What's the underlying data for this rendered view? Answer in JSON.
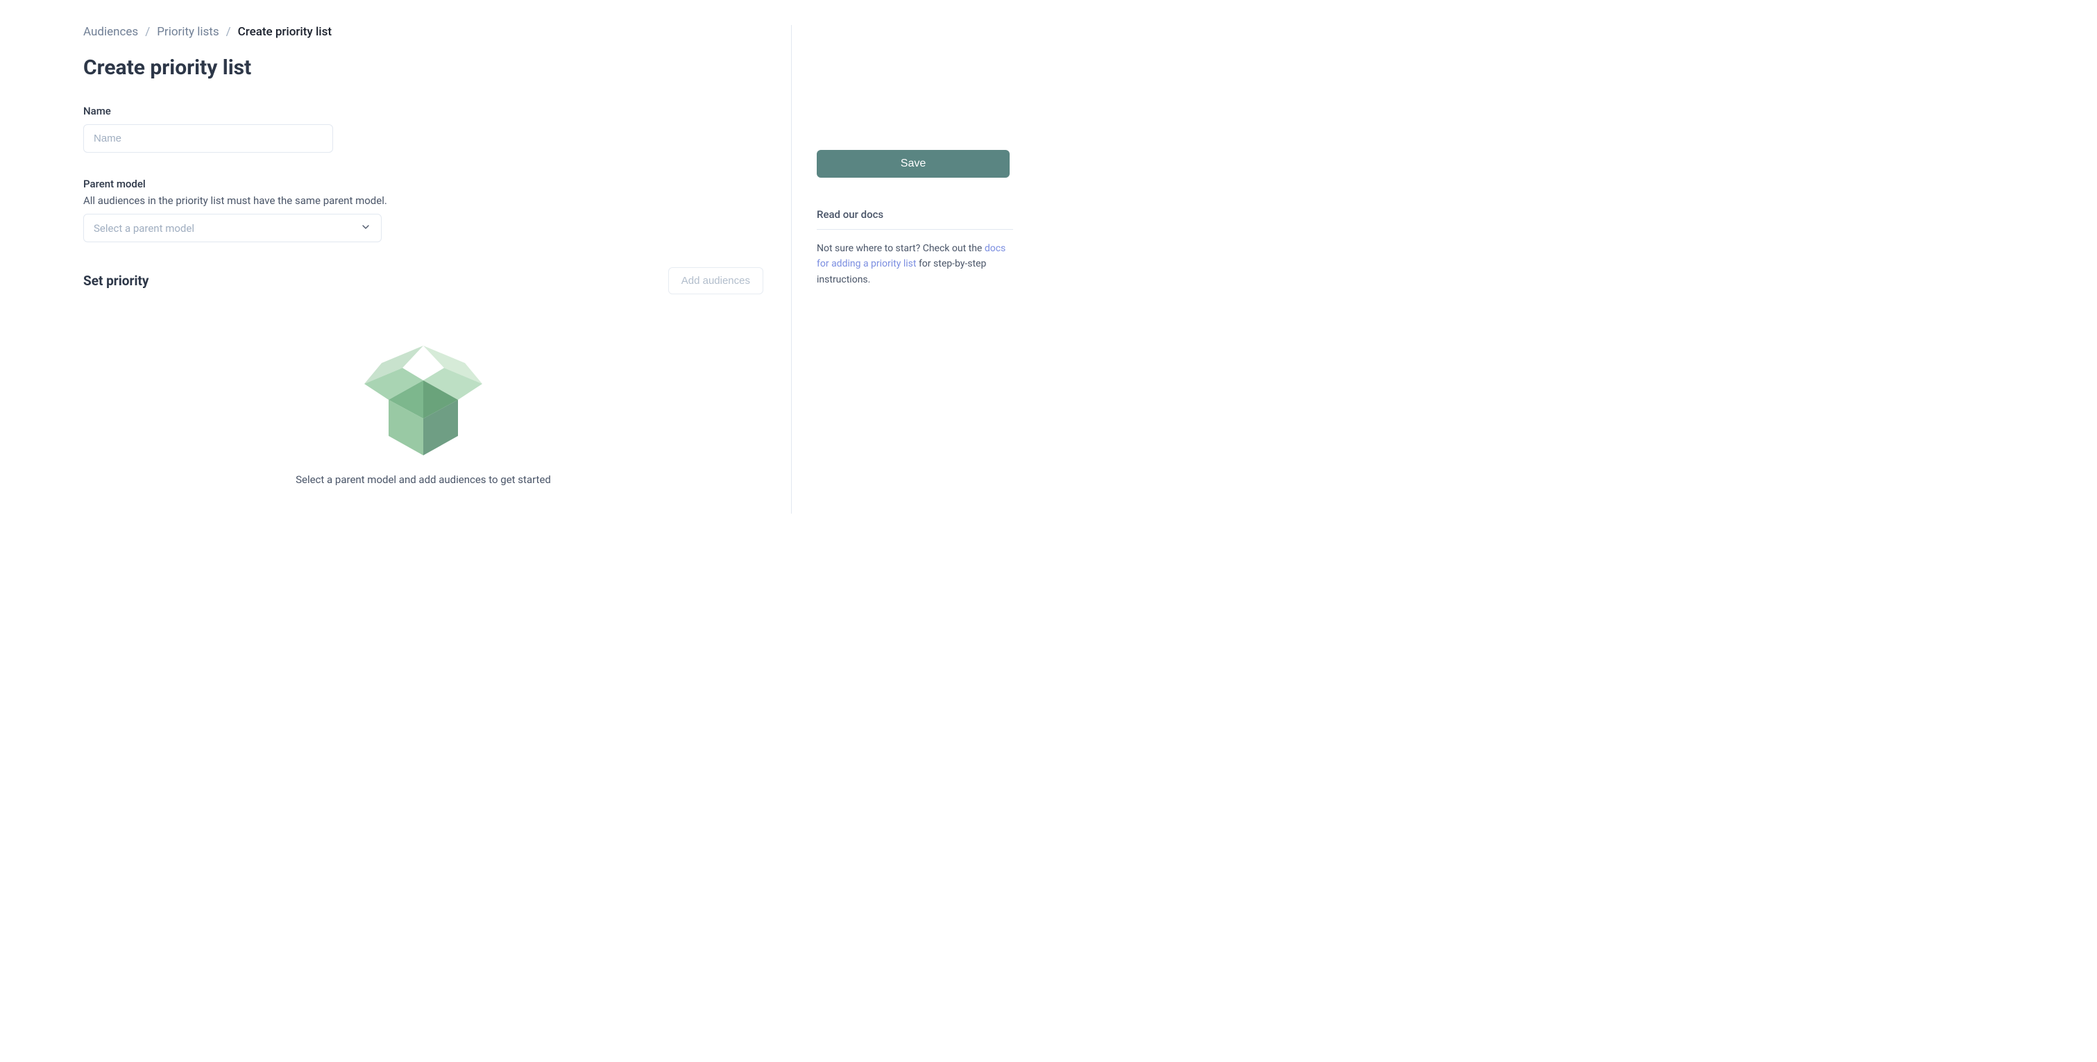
{
  "breadcrumb": {
    "items": [
      "Audiences",
      "Priority lists"
    ],
    "current": "Create priority list"
  },
  "page_title": "Create priority list",
  "fields": {
    "name": {
      "label": "Name",
      "placeholder": "Name",
      "value": ""
    },
    "parent_model": {
      "label": "Parent model",
      "helper": "All audiences in the priority list must have the same parent model.",
      "placeholder": "Select a parent model"
    }
  },
  "priority_section": {
    "heading": "Set priority",
    "add_button": "Add audiences",
    "empty_message": "Select a parent model and add audiences to get started"
  },
  "sidebar": {
    "save_button": "Save",
    "docs": {
      "heading": "Read our docs",
      "text_before": "Not sure where to start? Check out the ",
      "link_text": "docs for adding a priority list",
      "text_after": " for step-by-step instructions."
    }
  }
}
